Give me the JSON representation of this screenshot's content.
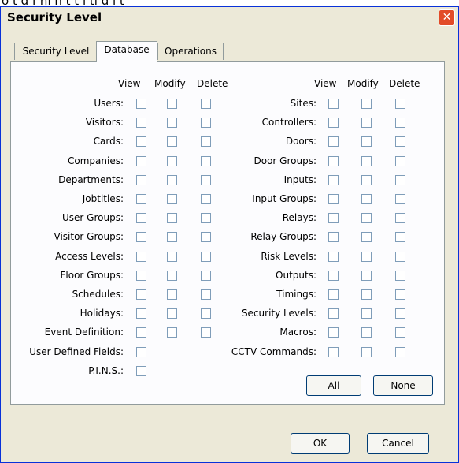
{
  "clipped_text": "o    t    d f    hi h    t    t   i ti        d  i    t",
  "window": {
    "title": "Security Level",
    "close_label": "✕"
  },
  "tabs": [
    {
      "label": "Security Level"
    },
    {
      "label": "Database"
    },
    {
      "label": "Operations"
    }
  ],
  "headers": {
    "view": "View",
    "modify": "Modify",
    "delete": "Delete"
  },
  "left_rows": [
    {
      "label": "Users:",
      "view": false,
      "modify": false,
      "delete": false
    },
    {
      "label": "Visitors:",
      "view": false,
      "modify": false,
      "delete": false
    },
    {
      "label": "Cards:",
      "view": false,
      "modify": false,
      "delete": false
    },
    {
      "label": "Companies:",
      "view": false,
      "modify": false,
      "delete": false
    },
    {
      "label": "Departments:",
      "view": false,
      "modify": false,
      "delete": false
    },
    {
      "label": "Jobtitles:",
      "view": false,
      "modify": false,
      "delete": false
    },
    {
      "label": "User Groups:",
      "view": false,
      "modify": false,
      "delete": false
    },
    {
      "label": "Visitor Groups:",
      "view": false,
      "modify": false,
      "delete": false
    },
    {
      "label": "Access Levels:",
      "view": false,
      "modify": false,
      "delete": false
    },
    {
      "label": "Floor Groups:",
      "view": false,
      "modify": false,
      "delete": false
    },
    {
      "label": "Schedules:",
      "view": false,
      "modify": false,
      "delete": false
    },
    {
      "label": "Holidays:",
      "view": false,
      "modify": false,
      "delete": false
    },
    {
      "label": "Event Definition:",
      "view": false,
      "modify": false,
      "delete": false
    },
    {
      "label": "User Defined Fields:",
      "view": false
    },
    {
      "label": "P.I.N.S.:",
      "view": false
    }
  ],
  "right_rows": [
    {
      "label": "Sites:",
      "view": false,
      "modify": false,
      "delete": false
    },
    {
      "label": "Controllers:",
      "view": false,
      "modify": false,
      "delete": false
    },
    {
      "label": "Doors:",
      "view": false,
      "modify": false,
      "delete": false
    },
    {
      "label": "Door Groups:",
      "view": false,
      "modify": false,
      "delete": false
    },
    {
      "label": "Inputs:",
      "view": false,
      "modify": false,
      "delete": false
    },
    {
      "label": "Input Groups:",
      "view": false,
      "modify": false,
      "delete": false
    },
    {
      "label": "Relays:",
      "view": false,
      "modify": false,
      "delete": false
    },
    {
      "label": "Relay Groups:",
      "view": false,
      "modify": false,
      "delete": false
    },
    {
      "label": "Risk Levels:",
      "view": false,
      "modify": false,
      "delete": false
    },
    {
      "label": "Outputs:",
      "view": false,
      "modify": false,
      "delete": false
    },
    {
      "label": "Timings:",
      "view": false,
      "modify": false,
      "delete": false
    },
    {
      "label": "Security Levels:",
      "view": false,
      "modify": false,
      "delete": false
    },
    {
      "label": "Macros:",
      "view": false,
      "modify": false,
      "delete": false
    },
    {
      "label": "CCTV Commands:",
      "view": false,
      "modify": false,
      "delete": false
    }
  ],
  "panel_buttons": {
    "all": "All",
    "none": "None"
  },
  "dialog_buttons": {
    "ok": "OK",
    "cancel": "Cancel"
  },
  "colors": {
    "titlebar_accent": "#0831d9",
    "close_button": "#e24b28",
    "window_face": "#ece9d8",
    "tab_panel": "#fcfcfe",
    "checkbox_border": "#7f9db9"
  }
}
